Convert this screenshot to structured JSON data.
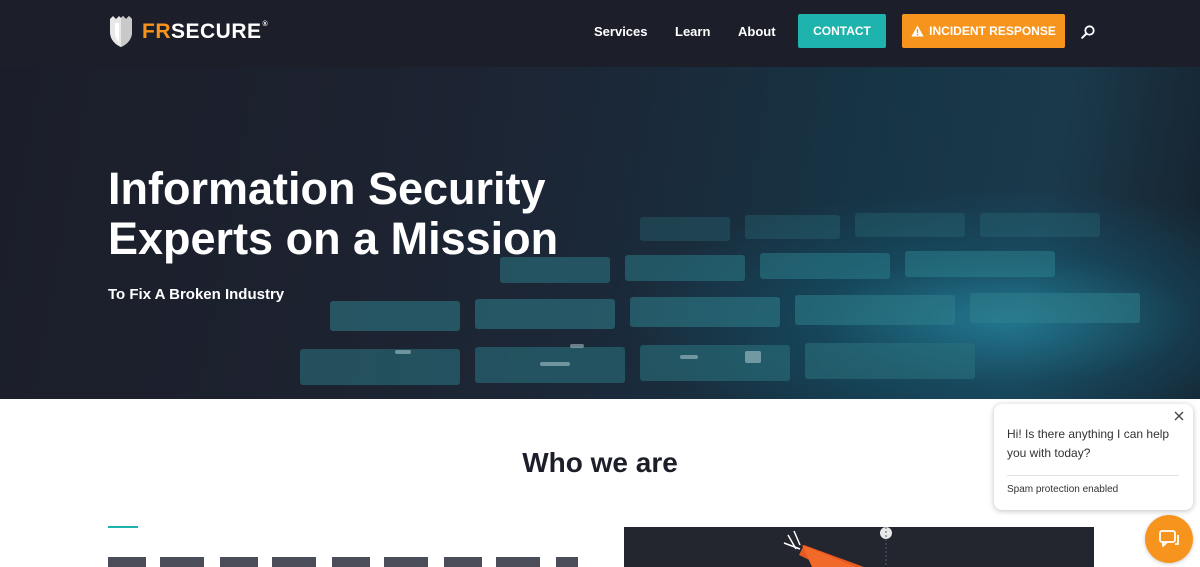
{
  "header": {
    "logo": {
      "part1": "FR",
      "part2": "SECURE",
      "tm": "®"
    },
    "nav": [
      {
        "label": "Services"
      },
      {
        "label": "Learn"
      },
      {
        "label": "About"
      }
    ],
    "contact_label": "CONTACT",
    "incident_label": "INCIDENT RESPONSE",
    "search_icon": "search-icon"
  },
  "hero": {
    "title": "Information Security Experts on a Mission",
    "subtitle": "To Fix A Broken Industry"
  },
  "who_we_are": {
    "title": "Who we are"
  },
  "chat": {
    "message": "Hi! Is there anything I can help you with today?",
    "spam_notice": "Spam protection enabled",
    "launcher_icon": "chat-bubble-icon"
  },
  "colors": {
    "header_bg": "#1c1f2a",
    "teal": "#1fb3ad",
    "orange": "#f7941d",
    "text_dark": "#1c1f2a"
  }
}
